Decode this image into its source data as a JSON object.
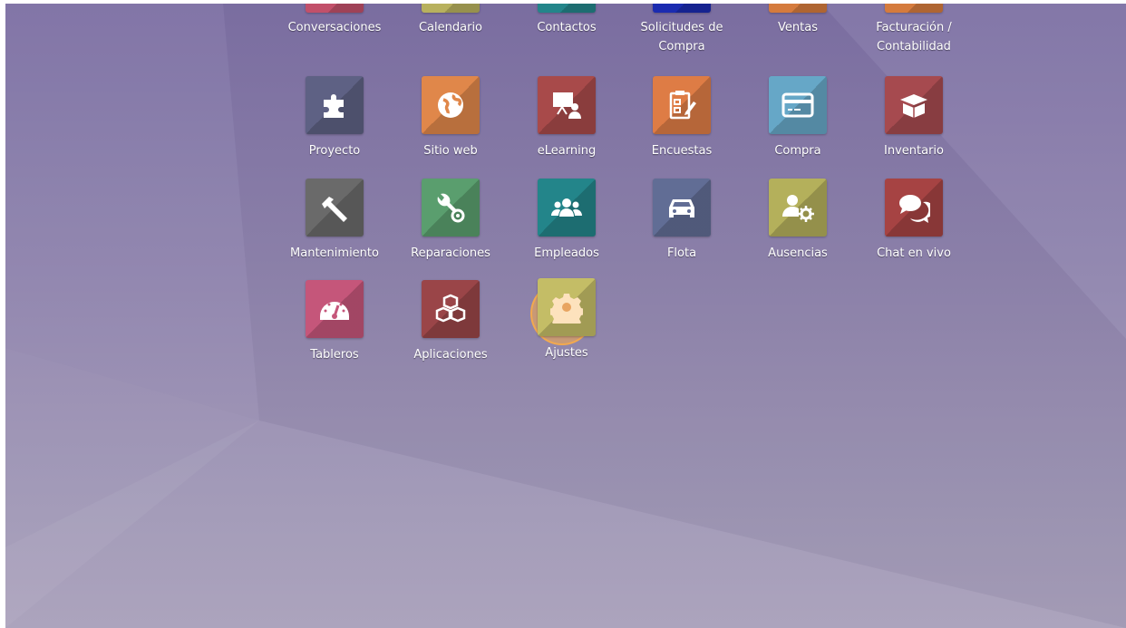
{
  "top_row": [
    {
      "label": "Conversaciones",
      "color": "#c2506a"
    },
    {
      "label": "Calendario",
      "color": "#b8b15e"
    },
    {
      "label": "Contactos",
      "color": "#23858a"
    },
    {
      "label": "Solicitudes de\nCompra",
      "color": "#1b2bb0"
    },
    {
      "label": "Ventas",
      "color": "#d57b3d"
    },
    {
      "label": "Facturación /\nContabilidad",
      "color": "#d57b3d"
    }
  ],
  "apps": [
    {
      "label": "Proyecto",
      "icon": "puzzle-icon",
      "color": "#5e6184"
    },
    {
      "label": "Sitio web",
      "icon": "globe-icon",
      "color": "#e0874a"
    },
    {
      "label": "eLearning",
      "icon": "presentation-icon",
      "color": "#a84a4a"
    },
    {
      "label": "Encuestas",
      "icon": "survey-icon",
      "color": "#de7c45"
    },
    {
      "label": "Compra",
      "icon": "credit-card-icon",
      "color": "#66a7c7"
    },
    {
      "label": "Inventario",
      "icon": "box-icon",
      "color": "#a64a4f"
    },
    {
      "label": "Mantenimiento",
      "icon": "hammer-icon",
      "color": "#6a6a6a"
    },
    {
      "label": "Reparaciones",
      "icon": "wrench-icon",
      "color": "#5a9e6e"
    },
    {
      "label": "Empleados",
      "icon": "users-icon",
      "color": "#23858a"
    },
    {
      "label": "Flota",
      "icon": "car-icon",
      "color": "#616d95"
    },
    {
      "label": "Ausencias",
      "icon": "user-gear-icon",
      "color": "#b4b05b"
    },
    {
      "label": "Chat en vivo",
      "icon": "chat-icon",
      "color": "#a64343"
    },
    {
      "label": "Tableros",
      "icon": "gauge-icon",
      "color": "#c5567a"
    },
    {
      "label": "Aplicaciones",
      "icon": "cubes-icon",
      "color": "#9a4548"
    },
    {
      "label": "Ajustes",
      "icon": "gear-icon",
      "color": "#c4bd66"
    }
  ]
}
